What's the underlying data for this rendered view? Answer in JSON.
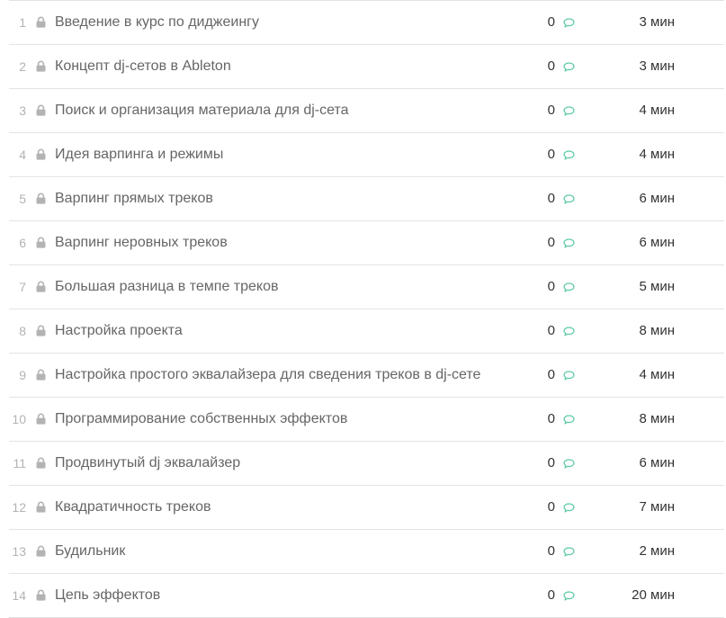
{
  "colors": {
    "divider": "#e3e3e3",
    "comment_icon": "#5cc9a7",
    "lock_icon": "#b3b3b3"
  },
  "lessons": [
    {
      "number": "1",
      "title": "Введение в курс по диджеингу",
      "comments": "0",
      "duration": "3 мин"
    },
    {
      "number": "2",
      "title": "Концепт dj-сетов в Ableton",
      "comments": "0",
      "duration": "3 мин"
    },
    {
      "number": "3",
      "title": "Поиск и организация материала для dj-сета",
      "comments": "0",
      "duration": "4 мин"
    },
    {
      "number": "4",
      "title": "Идея варпинга и режимы",
      "comments": "0",
      "duration": "4 мин"
    },
    {
      "number": "5",
      "title": "Варпинг прямых треков",
      "comments": "0",
      "duration": "6 мин"
    },
    {
      "number": "6",
      "title": "Варпинг неровных треков",
      "comments": "0",
      "duration": "6 мин"
    },
    {
      "number": "7",
      "title": "Большая разница в темпе треков",
      "comments": "0",
      "duration": "5 мин"
    },
    {
      "number": "8",
      "title": "Настройка проекта",
      "comments": "0",
      "duration": "8 мин"
    },
    {
      "number": "9",
      "title": "Настройка простого эквалайзера для сведения треков в dj-сете",
      "comments": "0",
      "duration": "4 мин"
    },
    {
      "number": "10",
      "title": "Программирование собственных эффектов",
      "comments": "0",
      "duration": "8 мин"
    },
    {
      "number": "11",
      "title": "Продвинутый dj эквалайзер",
      "comments": "0",
      "duration": "6 мин"
    },
    {
      "number": "12",
      "title": "Квадратичность треков",
      "comments": "0",
      "duration": "7 мин"
    },
    {
      "number": "13",
      "title": "Будильник",
      "comments": "0",
      "duration": "2 мин"
    },
    {
      "number": "14",
      "title": "Цепь эффектов",
      "comments": "0",
      "duration": "20 мин"
    }
  ]
}
